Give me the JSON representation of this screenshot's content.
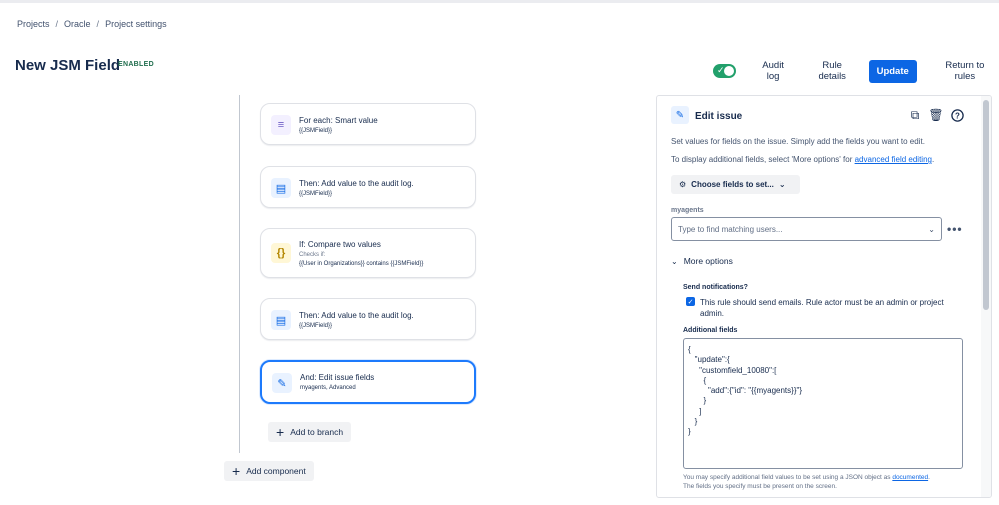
{
  "breadcrumb": [
    "Projects",
    "Oracle",
    "Project settings"
  ],
  "header": {
    "title": "New JSM Field",
    "status": "ENABLED",
    "toggle_on": true,
    "actions": {
      "audit_log": "Audit log",
      "rule_details": "Rule details",
      "update": "Update",
      "return": "Return to rules"
    }
  },
  "steps": [
    {
      "title": "For each: Smart value",
      "sub": "{{JSMField}}",
      "icon": "list-icon"
    },
    {
      "title": "Then: Add value to the audit log.",
      "sub": "{{JSMField}}",
      "icon": "document-icon"
    },
    {
      "title": "If: Compare two values",
      "sub_muted": "Checks if:",
      "sub": "{{User in Organizations}} contains {{JSMField}}",
      "icon": "braces-icon"
    },
    {
      "title": "Then: Add value to the audit log.",
      "sub": "{{JSMField}}",
      "icon": "document-icon"
    },
    {
      "title": "And: Edit issue fields",
      "sub": "myagents, Advanced",
      "icon": "pencil-icon"
    }
  ],
  "add_branch": "Add to branch",
  "add_component": "Add component",
  "panel": {
    "title": "Edit issue",
    "desc1": "Set values for fields on the issue. Simply add the fields you want to edit.",
    "desc2_prefix": "To display additional fields, select 'More options' for ",
    "desc2_link": "advanced field editing",
    "desc2_suffix": ".",
    "choose_fields": "Choose fields to set...",
    "field_label": "myagents",
    "field_placeholder": "Type to find matching users...",
    "more_options": "More options",
    "send_notifications_label": "Send notifications?",
    "send_notifications_text": "This rule should send emails. Rule actor must be an admin or project admin.",
    "send_notifications_checked": true,
    "additional_fields_label": "Additional fields",
    "json_lines": [
      "{",
      "   \"update\":{",
      "     \"customfield_10080\":[",
      "       {",
      "         \"add\":{\"id\": \"{{myagents}}\"}",
      "       }",
      "     ]",
      "   }",
      "}"
    ],
    "help_prefix": "You may specify additional field values to be set using a JSON object as ",
    "help_link": "documented",
    "help_suffix": ".",
    "help_line2": "The fields you specify must be present on the screen."
  },
  "colors": {
    "primary": "#0c66e4",
    "toggle_on": "#22a06b",
    "status_green": "#216e4e",
    "selected_border": "#1d7afc"
  }
}
